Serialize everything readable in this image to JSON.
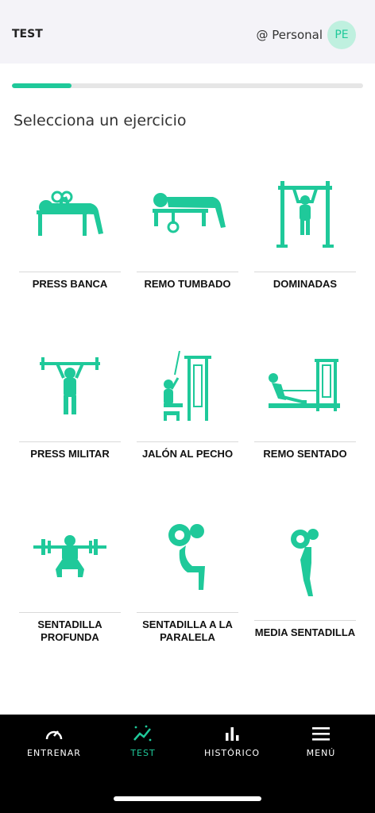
{
  "header": {
    "title": "TEST",
    "profile_label": "@ Personal",
    "avatar_initials": "PE"
  },
  "progress": {
    "value_percent": 17
  },
  "heading": "Selecciona un ejercicio",
  "exercises": [
    {
      "label": "PRESS BANCA",
      "icon": "bench-press-icon"
    },
    {
      "label": "REMO TUMBADO",
      "icon": "lying-row-icon"
    },
    {
      "label": "DOMINADAS",
      "icon": "pull-up-icon"
    },
    {
      "label": "PRESS MILITAR",
      "icon": "military-press-icon"
    },
    {
      "label": "JALÓN AL PECHO",
      "icon": "lat-pulldown-icon"
    },
    {
      "label": "REMO SENTADO",
      "icon": "seated-row-icon"
    },
    {
      "label": "SENTADILLA PROFUNDA",
      "icon": "deep-squat-icon"
    },
    {
      "label": "SENTADILLA A LA PARALELA",
      "icon": "parallel-squat-icon"
    },
    {
      "label": "MEDIA SENTADILLA",
      "icon": "half-squat-icon"
    }
  ],
  "nav": [
    {
      "label": "ENTRENAR",
      "icon": "gauge-icon",
      "active": false
    },
    {
      "label": "TEST",
      "icon": "trend-chart-icon",
      "active": true
    },
    {
      "label": "HISTÓRICO",
      "icon": "bar-chart-icon",
      "active": false
    },
    {
      "label": "MENÚ",
      "icon": "hamburger-menu-icon",
      "active": false
    }
  ],
  "colors": {
    "accent": "#1fc99a",
    "avatar_bg": "#bff0df",
    "header_bg": "#f4f3f8",
    "navbar_bg": "#000000"
  }
}
